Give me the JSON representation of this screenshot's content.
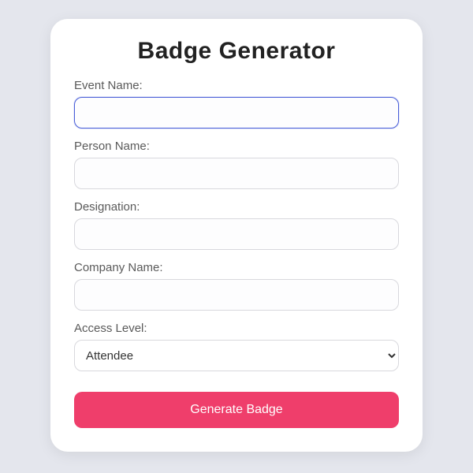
{
  "title": "Badge Generator",
  "fields": {
    "event_name": {
      "label": "Event Name:",
      "value": ""
    },
    "person_name": {
      "label": "Person Name:",
      "value": ""
    },
    "designation": {
      "label": "Designation:",
      "value": ""
    },
    "company_name": {
      "label": "Company Name:",
      "value": ""
    },
    "access_level": {
      "label": "Access Level:",
      "selected": "Attendee"
    }
  },
  "button": {
    "generate": "Generate Badge"
  }
}
